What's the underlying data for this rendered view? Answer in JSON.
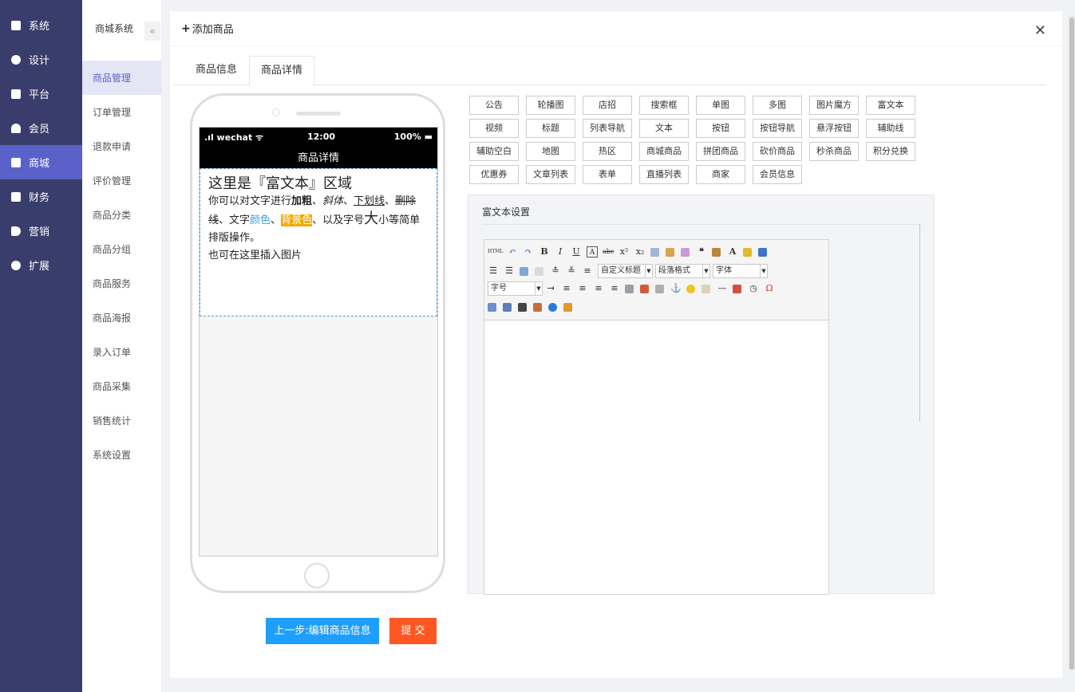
{
  "sidebar": {
    "items": [
      {
        "label": "系统",
        "icon": "system-icon"
      },
      {
        "label": "设计",
        "icon": "design-icon"
      },
      {
        "label": "平台",
        "icon": "platform-icon"
      },
      {
        "label": "会员",
        "icon": "member-icon"
      },
      {
        "label": "商城",
        "icon": "mall-icon",
        "active": true
      },
      {
        "label": "财务",
        "icon": "finance-icon"
      },
      {
        "label": "营销",
        "icon": "marketing-icon"
      },
      {
        "label": "扩展",
        "icon": "extend-icon"
      }
    ]
  },
  "subnav": {
    "title": "商城系统",
    "collapse_glyph": "«",
    "items": [
      {
        "label": "商品管理",
        "active": true
      },
      {
        "label": "订单管理"
      },
      {
        "label": "退款申请"
      },
      {
        "label": "评价管理"
      },
      {
        "label": "商品分类"
      },
      {
        "label": "商品分组"
      },
      {
        "label": "商品服务"
      },
      {
        "label": "商品海报"
      },
      {
        "label": "录入订单"
      },
      {
        "label": "商品采集"
      },
      {
        "label": "销售统计"
      },
      {
        "label": "系统设置"
      }
    ]
  },
  "panel": {
    "title": "添加商品",
    "plus_glyph": "+",
    "close_glyph": "✕"
  },
  "tabs": [
    {
      "label": "商品信息"
    },
    {
      "label": "商品详情",
      "active": true
    }
  ],
  "phone": {
    "carrier": ".ıl wechat ᯤ",
    "time": "12:00",
    "battery": "100% ▬",
    "page_title": "商品详情",
    "rich": {
      "title": "这里是『富文本』区域",
      "t1": "你可以对文字进行",
      "bold": "加粗",
      "sep1": "、",
      "italic": "斜体",
      "sep2": "、",
      "underline": "下划线",
      "sep3": "、",
      "strike": "删除线",
      "t2": "、文字",
      "color": "颜色",
      "sep4": "、",
      "bg": "背景色",
      "t3": "、以及字号",
      "big": "大",
      "t4": "小等简单排版操作。",
      "line3": "也可在这里插入图片"
    }
  },
  "components": {
    "row1": [
      "公告",
      "轮播图",
      "店招",
      "搜索框",
      "单图",
      "多图",
      "图片魔方",
      "富文本"
    ],
    "row2": [
      "视频",
      "标题",
      "列表导航",
      "文本",
      "按钮",
      "按钮导航",
      "悬浮按钮",
      "辅助线"
    ],
    "row3": [
      "辅助空白",
      "地图",
      "热区",
      "商城商品",
      "拼团商品",
      "砍价商品",
      "秒杀商品",
      "积分兑换"
    ],
    "row4": [
      "优惠券",
      "文章列表",
      "表单",
      "直播列表",
      "商家",
      "会员信息"
    ]
  },
  "settings": {
    "title": "富文本设置",
    "editor": {
      "html_label": "HTML",
      "custom_title": "自定义标题",
      "paragraph": "段落格式",
      "font": "字体",
      "font_size": "字号"
    }
  },
  "buttons": {
    "prev": "上一步:编辑商品信息",
    "submit": "提 交"
  },
  "colors": {
    "sidebar_bg": "#393d6b",
    "active": "#5a62c9",
    "primary": "#1e9fff",
    "danger": "#ff5722",
    "highlight": "#f5a800",
    "text_blue": "#3ba0f5"
  }
}
